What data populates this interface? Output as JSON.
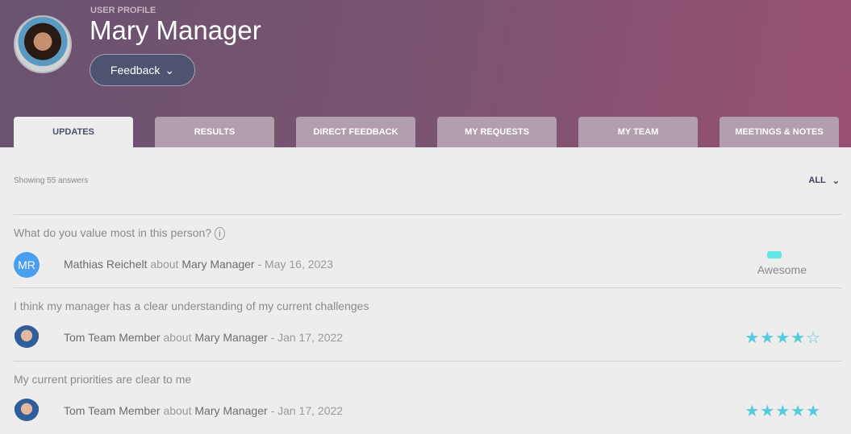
{
  "header": {
    "eyebrow": "USER PROFILE",
    "name": "Mary Manager",
    "feedback_button": "Feedback"
  },
  "tabs": [
    {
      "label": "UPDATES",
      "active": true
    },
    {
      "label": "RESULTS"
    },
    {
      "label": "DIRECT FEEDBACK"
    },
    {
      "label": "MY REQUESTS"
    },
    {
      "label": "MY TEAM"
    },
    {
      "label": "MEETINGS & NOTES"
    }
  ],
  "filter": {
    "showing": "Showing 55 answers",
    "value": "ALL"
  },
  "answers": [
    {
      "question": "What do you value most in this person?",
      "author": "Mathias Reichelt",
      "initials": "MR",
      "about": "about",
      "subject": "Mary Manager",
      "date": "- May 16, 2023",
      "answer": "Awesome"
    },
    {
      "question": "I think my manager has a clear understanding of my current challenges",
      "author": "Tom Team Member",
      "about": "about",
      "subject": "Mary Manager",
      "date": "- Jan 17, 2022",
      "stars": 4,
      "max_stars": 5
    },
    {
      "question": "My current priorities are clear to me",
      "author": "Tom Team Member",
      "about": "about",
      "subject": "Mary Manager",
      "date": "- Jan 17, 2022",
      "stars": 5,
      "max_stars": 5
    }
  ],
  "colors": {
    "accent": "#55ccdd",
    "avatar": "#4a9ef0"
  }
}
